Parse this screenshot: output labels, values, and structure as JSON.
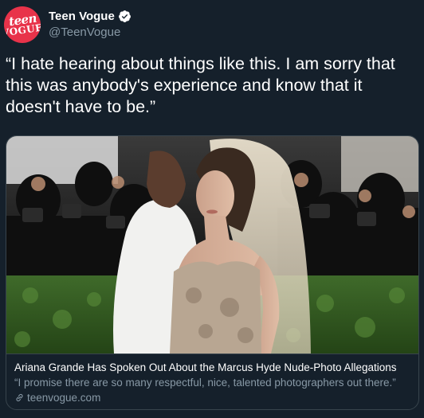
{
  "author": {
    "display_name": "Teen Vogue",
    "handle": "@TeenVogue",
    "verified": true,
    "avatar_text_line1": "teen",
    "avatar_text_line2": "VOGUE",
    "avatar_color": "#e8334a"
  },
  "tweet": {
    "text": "“I hate hearing about things like this. I am sorry that this was anybody's experience and know that it doesn't have to be.”"
  },
  "card": {
    "title": "Ariana Grande Has Spoken Out About the Marcus Hyde Nude-Photo Allegations",
    "description": "“I promise there are so many respectful, nice, talented photographers out there.”",
    "domain": "teenvogue.com",
    "icon": "link-icon"
  },
  "colors": {
    "background": "#15202b",
    "text": "#ffffff",
    "secondary_text": "#8899a6",
    "verified_badge": "#ffffff",
    "border": "#38444d"
  }
}
